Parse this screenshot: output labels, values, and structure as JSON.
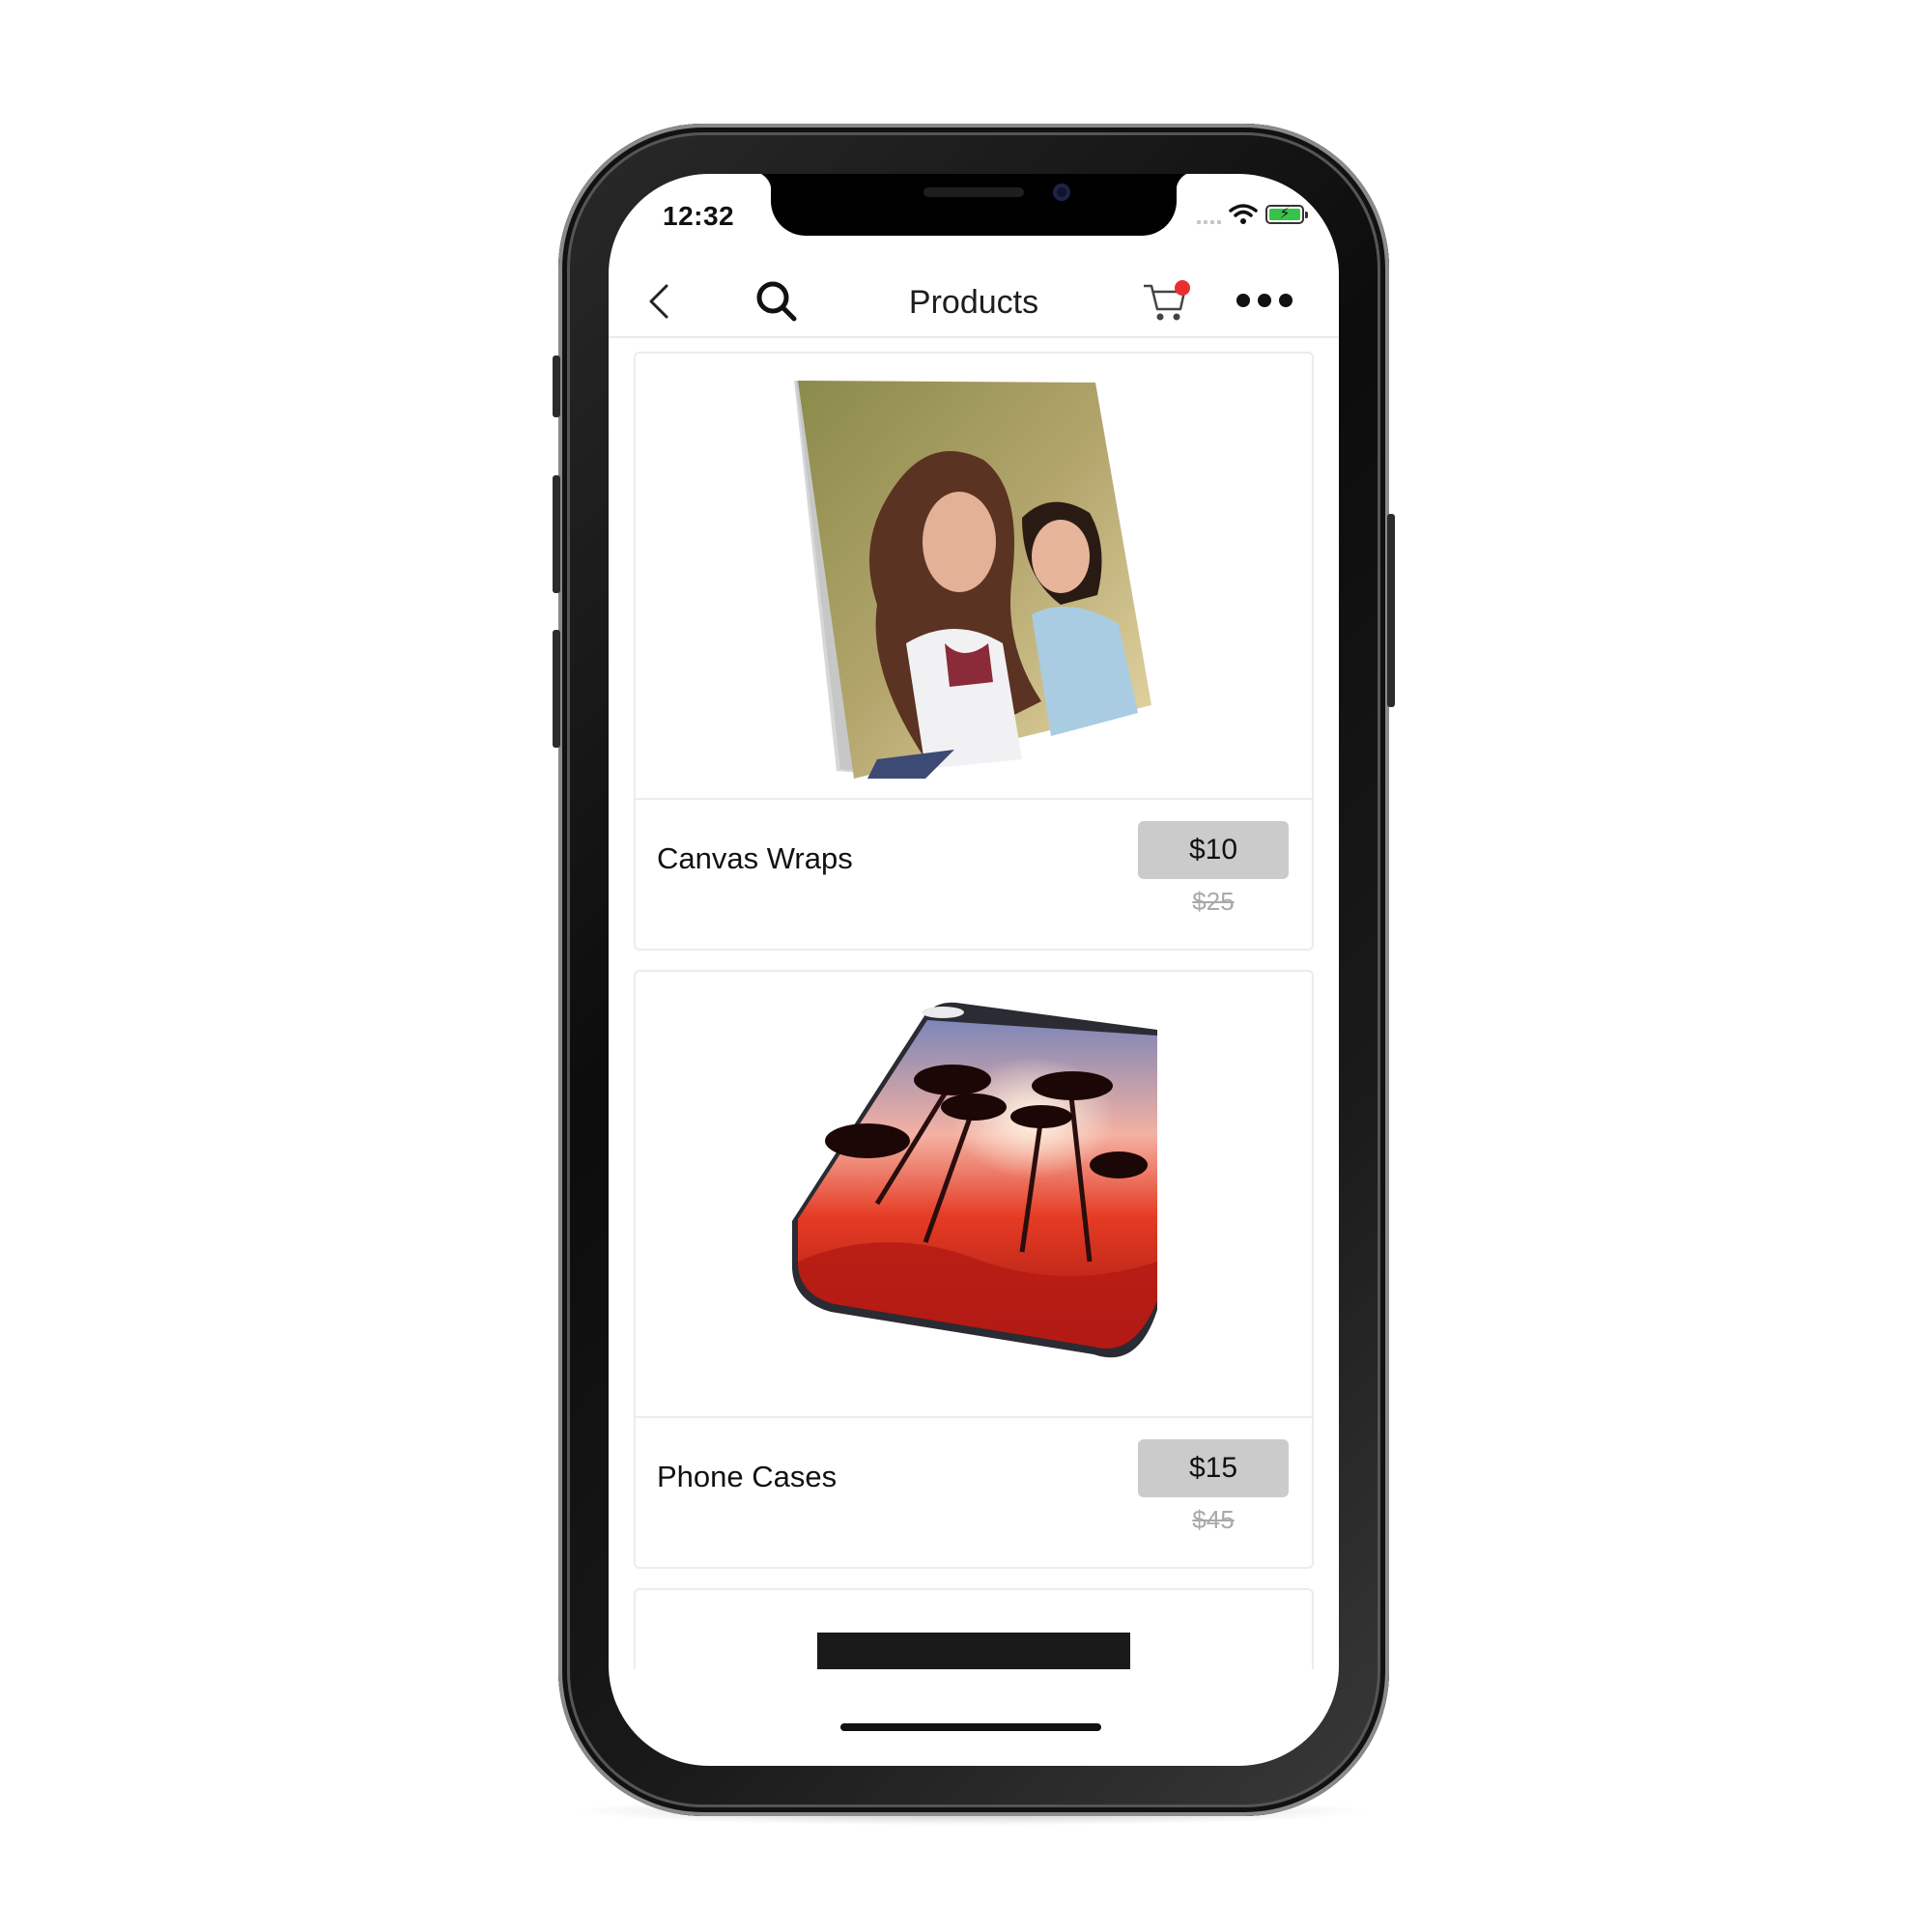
{
  "status_bar": {
    "time": "12:32",
    "battery_color": "#37c24a",
    "icons": [
      "signal-dots-icon",
      "wifi-icon",
      "battery-charging-icon"
    ]
  },
  "nav": {
    "title": "Products",
    "back_icon": "chevron-left-icon",
    "search_icon": "search-icon",
    "cart_icon": "cart-icon",
    "cart_badge_color": "#ea2e2e",
    "more_icon": "more-dots-icon"
  },
  "products": [
    {
      "name": "Canvas Wraps",
      "price": "$10",
      "original_price": "$25",
      "image": "canvas-photo-image"
    },
    {
      "name": "Phone Cases",
      "price": "$15",
      "original_price": "$45",
      "image": "phone-case-image"
    },
    {
      "image": "partially-visible-product-image"
    }
  ],
  "colors": {
    "price_button_bg": "#cbcbcb",
    "old_price_text": "#a9a9a9",
    "card_border": "#ececec"
  }
}
